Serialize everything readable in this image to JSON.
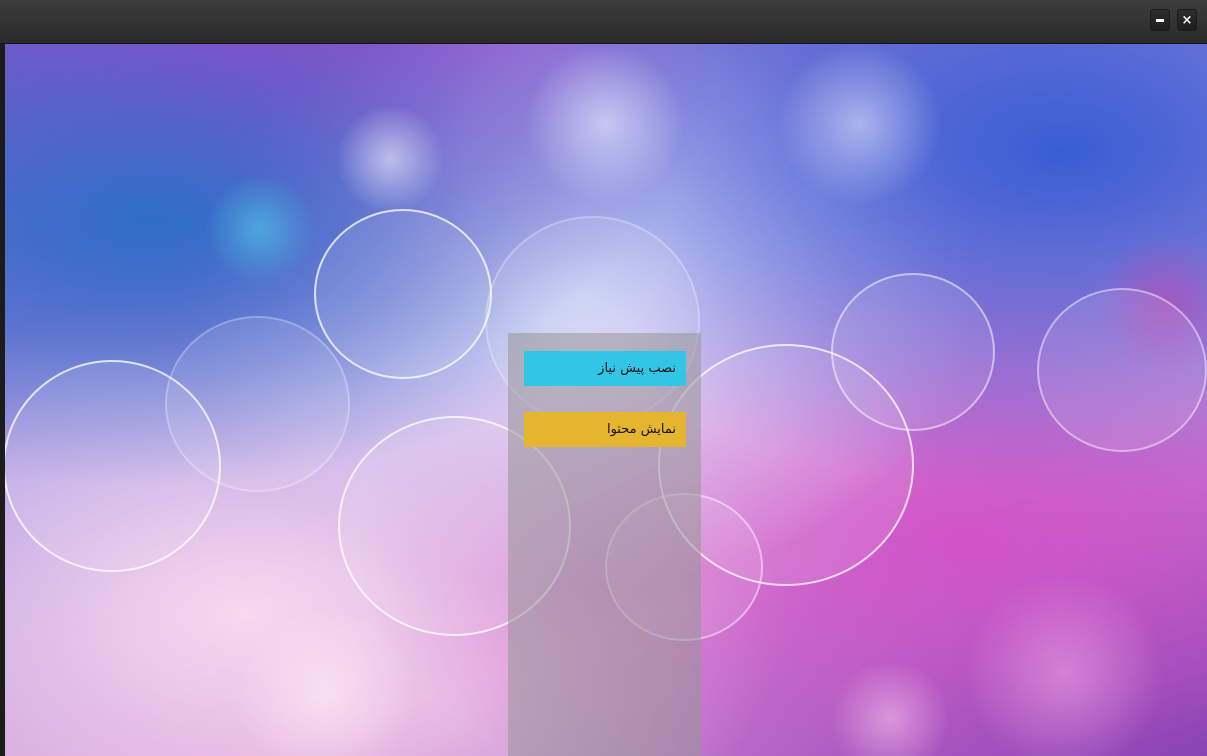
{
  "window": {
    "minimize_icon": "minimize-icon",
    "close_icon": "close-icon",
    "close_glyph": "×"
  },
  "actions": {
    "install_prerequisites_label": "نصب پیش نیاز",
    "install_prerequisites_color": "#31c6e6",
    "show_content_label": "نمایش محتوا",
    "show_content_color": "#e6b530"
  },
  "colors": {
    "titlebar": "#2f2f2f",
    "panel": "rgba(150,150,150,0.55)"
  }
}
